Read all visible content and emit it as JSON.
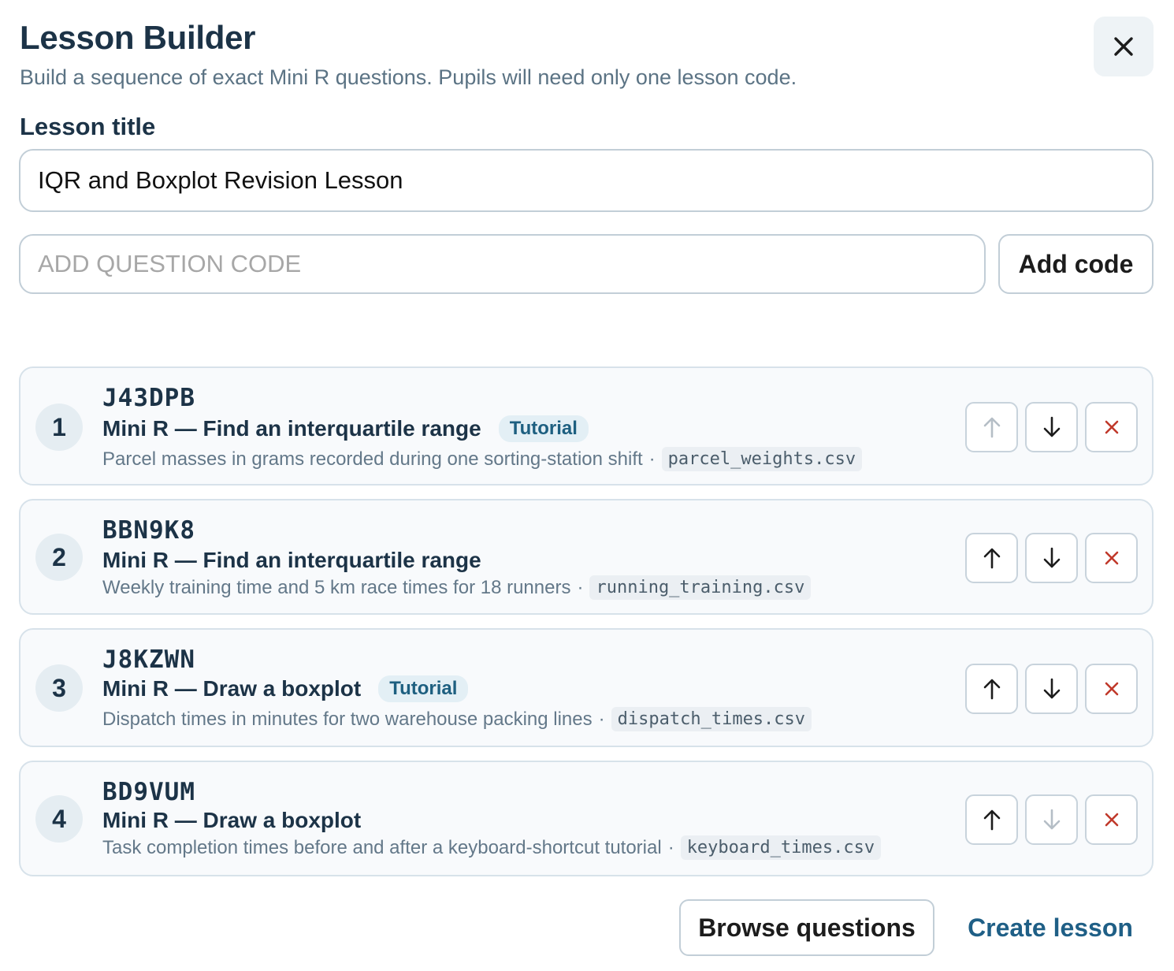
{
  "header": {
    "title": "Lesson Builder",
    "subtitle": "Build a sequence of exact Mini R questions. Pupils will need only one lesson code.",
    "close_icon": "close-icon"
  },
  "form": {
    "lesson_title_label": "Lesson title",
    "lesson_title_value": "IQR and Boxplot Revision Lesson",
    "code_placeholder": "ADD QUESTION CODE",
    "code_value": "",
    "add_code_label": "Add code"
  },
  "questions": [
    {
      "number": "1",
      "code": "J43DPB",
      "title": "Mini R — Find an interquartile range",
      "badge": "Tutorial",
      "description": "Parcel masses in grams recorded during one sorting-station shift",
      "separator": "·",
      "file": "parcel_weights.csv",
      "up_enabled": false,
      "down_enabled": true
    },
    {
      "number": "2",
      "code": "BBN9K8",
      "title": "Mini R — Find an interquartile range",
      "badge": "",
      "description": "Weekly training time and 5 km race times for 18 runners",
      "separator": "·",
      "file": "running_training.csv",
      "up_enabled": true,
      "down_enabled": true
    },
    {
      "number": "3",
      "code": "J8KZWN",
      "title": "Mini R — Draw a boxplot",
      "badge": "Tutorial",
      "description": "Dispatch times in minutes for two warehouse packing lines",
      "separator": "·",
      "file": "dispatch_times.csv",
      "up_enabled": true,
      "down_enabled": true
    },
    {
      "number": "4",
      "code": "BD9VUM",
      "title": "Mini R — Draw a boxplot",
      "badge": "",
      "description": "Task completion times before and after a keyboard-shortcut tutorial",
      "separator": "·",
      "file": "keyboard_times.csv",
      "up_enabled": true,
      "down_enabled": false
    }
  ],
  "footer": {
    "browse_label": "Browse questions",
    "create_label": "Create lesson"
  },
  "colors": {
    "accent": "#1f5f86",
    "remove": "#c0392b",
    "heading": "#1c3347",
    "muted": "#637889"
  }
}
